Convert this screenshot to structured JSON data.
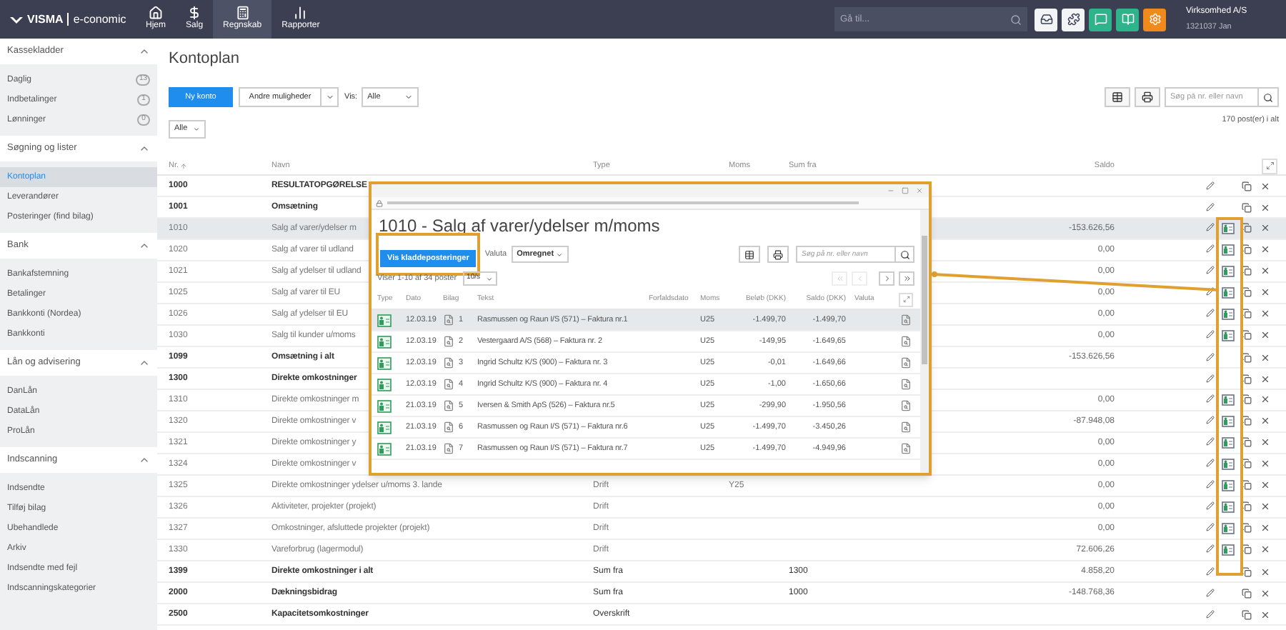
{
  "topbar": {
    "logo": "VISMA",
    "product": "e-conomic",
    "nav": [
      {
        "label": "Hjem",
        "kind": "home",
        "selected": false
      },
      {
        "label": "Salg",
        "kind": "sales",
        "selected": false
      },
      {
        "label": "Regnskab",
        "kind": "accounting",
        "selected": true
      },
      {
        "label": "Rapporter",
        "kind": "reports",
        "selected": false
      }
    ],
    "search": {
      "placeholder": "Gå til..."
    },
    "company": "Virksomhed A/S",
    "user": "1321037 Jan"
  },
  "sidebar": {
    "sections": [
      {
        "title": "Kassekladder",
        "expanded": true,
        "items": [
          {
            "label": "Daglig",
            "count": "13",
            "selected": false
          },
          {
            "label": "Indbetalinger",
            "count": "1",
            "selected": false
          },
          {
            "label": "Lønninger",
            "count": "0",
            "selected": false
          }
        ]
      },
      {
        "title": "Søgning og lister",
        "expanded": true,
        "items": [
          {
            "label": "Kontoplan",
            "selected": true
          },
          {
            "label": "Leverandører",
            "selected": false
          },
          {
            "label": "Posteringer (find bilag)",
            "selected": false
          }
        ]
      },
      {
        "title": "Bank",
        "expanded": true,
        "items": [
          {
            "label": "Bankafstemning",
            "selected": false
          },
          {
            "label": "Betalinger",
            "selected": false
          },
          {
            "label": "Bankkonti (Nordea)",
            "selected": false
          },
          {
            "label": "Bankkonti",
            "selected": false
          }
        ]
      },
      {
        "title": "Lån og advisering",
        "expanded": true,
        "items": [
          {
            "label": "DanLån",
            "selected": false
          },
          {
            "label": "DataLån",
            "selected": false
          },
          {
            "label": "ProLån",
            "selected": false
          }
        ]
      },
      {
        "title": "Indscanning",
        "expanded": true,
        "items": [
          {
            "label": "Indsendte",
            "selected": false
          },
          {
            "label": "Tilføj bilag",
            "selected": false
          },
          {
            "label": "Ubehandlede",
            "selected": false
          },
          {
            "label": "Arkiv",
            "selected": false
          },
          {
            "label": "Indsendte med fejl",
            "selected": false
          },
          {
            "label": "Indscanningskategorier",
            "selected": false
          }
        ]
      }
    ]
  },
  "page": {
    "title": "Kontoplan",
    "new_button": "Ny konto",
    "more_button": "Andre muligheder",
    "view_label": "Vis:",
    "view_select": "Alle",
    "search": {
      "placeholder": "Søg på nr. eller navn"
    },
    "filter_select": "Alle",
    "count": "170 post(er) i alt"
  },
  "table": {
    "columns": [
      "Nr.",
      "Navn",
      "Type",
      "Moms",
      "Sum fra",
      "Saldo"
    ],
    "rows": [
      {
        "nr": "1000",
        "name": "RESULTATOPGØRELSE",
        "kind": "heading",
        "selected": false
      },
      {
        "nr": "1001",
        "name": "Omsætning",
        "kind": "heading",
        "selected": false
      },
      {
        "nr": "1010",
        "name": "Salg af varer/ydelser m",
        "balance": "-153.626,56",
        "kind": "account",
        "selected": true
      },
      {
        "nr": "1020",
        "name": "Salg af varer til udland",
        "balance": "0,00",
        "kind": "account",
        "selected": false
      },
      {
        "nr": "1021",
        "name": "Salg af ydelser til udland",
        "balance": "0,00",
        "kind": "account",
        "selected": false
      },
      {
        "nr": "1025",
        "name": "Salg af varer til EU",
        "balance": "0,00",
        "kind": "account",
        "selected": false
      },
      {
        "nr": "1026",
        "name": "Salg af ydelser til EU",
        "balance": "0,00",
        "kind": "account",
        "selected": false
      },
      {
        "nr": "1030",
        "name": "Salg til kunder u/moms",
        "balance": "0,00",
        "kind": "account",
        "selected": false
      },
      {
        "nr": "1099",
        "name": "Omsætning i alt",
        "balance": "-153.626,56",
        "kind": "heading",
        "selected": false
      },
      {
        "nr": "1300",
        "name": "Direkte omkostninger",
        "kind": "heading",
        "selected": false
      },
      {
        "nr": "1310",
        "name": "Direkte omkostninger m",
        "balance": "0,00",
        "kind": "account",
        "selected": false
      },
      {
        "nr": "1320",
        "name": "Direkte omkostninger v",
        "balance": "-87.948,08",
        "kind": "account",
        "selected": false
      },
      {
        "nr": "1321",
        "name": "Direkte omkostninger y",
        "balance": "0,00",
        "kind": "account",
        "selected": false
      },
      {
        "nr": "1324",
        "name": "Direkte omkostninger v",
        "balance": "0,00",
        "kind": "account",
        "selected": false
      },
      {
        "nr": "1325",
        "name": "Direkte omkostninger ydelser u/moms 3. lande",
        "type": "Drift",
        "vat": "Y25",
        "balance": "0,00",
        "kind": "account",
        "selected": false
      },
      {
        "nr": "1326",
        "name": "Aktiviteter, projekter (projekt)",
        "type": "Drift",
        "balance": "0,00",
        "kind": "account",
        "selected": false
      },
      {
        "nr": "1327",
        "name": "Omkostninger, afsluttede projekter (projekt)",
        "type": "Drift",
        "balance": "0,00",
        "kind": "account",
        "selected": false
      },
      {
        "nr": "1330",
        "name": "Vareforbrug (lagermodul)",
        "type": "Drift",
        "balance": "72.606,26",
        "kind": "account",
        "selected": false
      },
      {
        "nr": "1399",
        "name": "Direkte omkostninger i alt",
        "type": "Sum fra",
        "sum_from": "1300",
        "balance": "4.858,20",
        "kind": "heading",
        "selected": false
      },
      {
        "nr": "2000",
        "name": "Dækningsbidrag",
        "type": "Sum fra",
        "sum_from": "1000",
        "balance": "-148.768,36",
        "kind": "heading",
        "selected": false
      },
      {
        "nr": "2500",
        "name": "Kapacitetsomkostninger",
        "type": "Overskrift",
        "kind": "heading",
        "selected": false
      }
    ]
  },
  "popup": {
    "title": "1010 - Salg af varer/ydelser m/moms",
    "entries_button": "Vis kladdeposteringer",
    "currency_label": "Valuta",
    "currency_select": "Omregnet",
    "search": {
      "placeholder": "Søg på nr. eller navn"
    },
    "range": "Viser 1-10 af 34 poster",
    "page_size": "10/s",
    "pager": [
      {
        "kind": "first",
        "disabled": true
      },
      {
        "kind": "prev",
        "disabled": true
      },
      {
        "kind": "next",
        "disabled": false
      },
      {
        "kind": "last",
        "disabled": false
      }
    ],
    "columns": [
      "Type",
      "Dato",
      "Bilag",
      "Tekst",
      "Forfaldsdato",
      "Moms",
      "Beløb (DKK)",
      "Saldo (DKK)",
      "Valuta"
    ],
    "rows": [
      {
        "date": "12.03.19",
        "voucher": "1",
        "text": "Rasmussen og Raun I/S (571) – Faktura nr.1",
        "vat": "U25",
        "amount": "-1.499,70",
        "balance": "-1.499,70",
        "selected": true
      },
      {
        "date": "12.03.19",
        "voucher": "2",
        "text": "Vestergaard A/S (568) – Faktura nr. 2",
        "vat": "U25",
        "amount": "-149,95",
        "balance": "-1.649,65",
        "selected": false
      },
      {
        "date": "12.03.19",
        "voucher": "3",
        "text": "Ingrid Schultz K/S (900) – Faktura nr. 3",
        "vat": "U25",
        "amount": "-0,01",
        "balance": "-1.649,66",
        "selected": false
      },
      {
        "date": "12.03.19",
        "voucher": "4",
        "text": "Ingrid Schultz K/S (900) – Faktura nr. 4",
        "vat": "U25",
        "amount": "-1,00",
        "balance": "-1.650,66",
        "selected": false
      },
      {
        "date": "21.03.19",
        "voucher": "5",
        "text": "Iversen & Smith ApS (526) – Faktura nr.5",
        "vat": "U25",
        "amount": "-299,90",
        "balance": "-1.950,56",
        "selected": false
      },
      {
        "date": "21.03.19",
        "voucher": "6",
        "text": "Rasmussen og Raun I/S (571) – Faktura nr.6",
        "vat": "U25",
        "amount": "-1.499,70",
        "balance": "-3.450,26",
        "selected": false
      },
      {
        "date": "21.03.19",
        "voucher": "7",
        "text": "Rasmussen og Raun I/S (571) – Faktura nr.7",
        "vat": "U25",
        "amount": "-1.499,70",
        "balance": "-4.949,96",
        "selected": false
      }
    ]
  }
}
